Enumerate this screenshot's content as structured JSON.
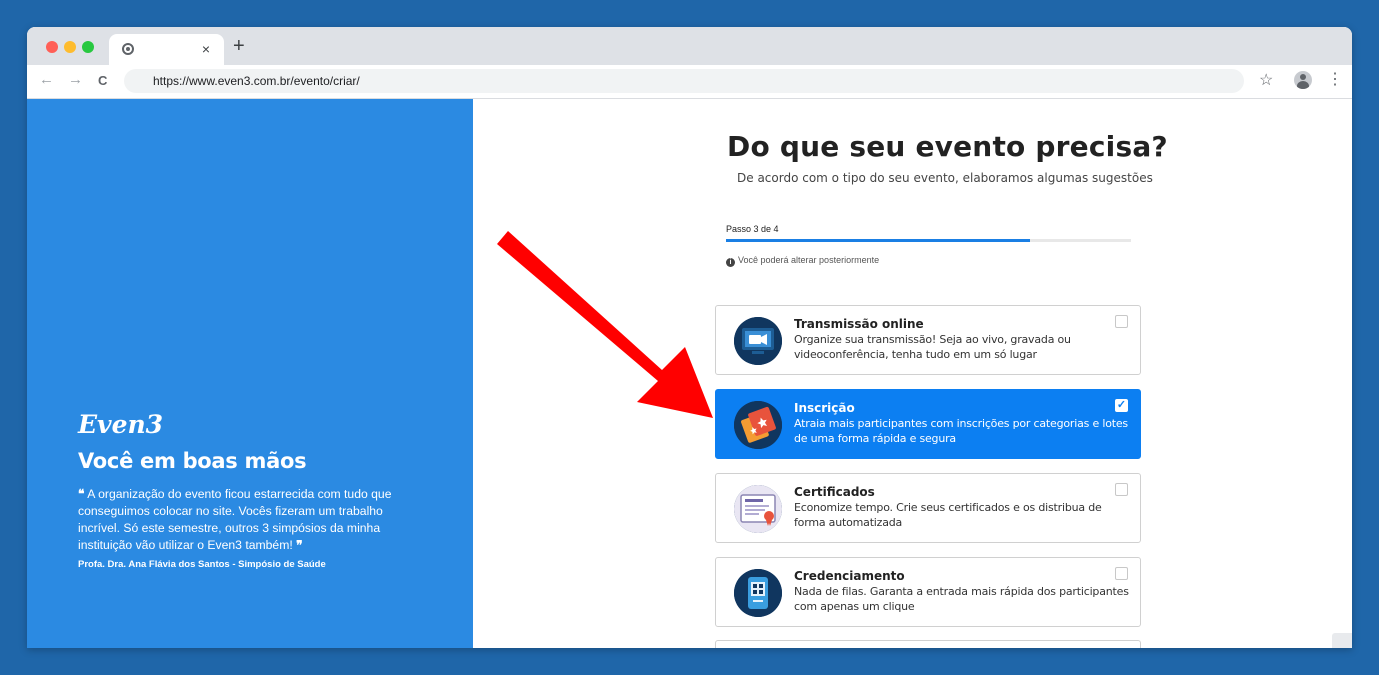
{
  "browser": {
    "tab_close": "×",
    "new_tab": "+",
    "back": "←",
    "forward": "→",
    "reload": "C",
    "url": "https://www.even3.com.br/evento/criar/",
    "star": "☆",
    "menu": "⋮",
    "colors": {
      "close": "#ff5f57",
      "minimize": "#febc2e",
      "maximize": "#28c840"
    }
  },
  "sidebar": {
    "logo": "Even3",
    "tagline": "Você em boas mãos",
    "open_quote": "❝",
    "testimonial": "A organização do evento ficou estarrecida com tudo que conseguimos colocar no site. Vocês fizeram um trabalho incrível. Só este semestre, outros 3 simpósios da minha instituição vão utilizar o Even3 também!",
    "close_quote": "❞",
    "author": "Profa. Dra. Ana Flávia dos Santos - Simpósio de Saúde",
    "background_color": "#2b8ae2"
  },
  "main": {
    "title": "Do que seu evento precisa?",
    "subtitle": "De acordo com o tipo do seu evento, elaboramos algumas sugestões",
    "step_label": "Passo 3 de 4",
    "progress_fraction": 0.75,
    "note_icon": "i",
    "note": "Você poderá alterar posteriormente",
    "checkmark": "✓",
    "options": [
      {
        "title": "Transmissão online",
        "description": "Organize sua transmissão! Seja ao vivo, gravada ou videoconferência, tenha tudo em um só lugar",
        "icon": "video-camera-icon",
        "selected": false
      },
      {
        "title": "Inscrição",
        "description": "Atraia mais participantes com inscrições por categorias e lotes de uma forma rápida e segura",
        "icon": "ticket-icon",
        "selected": true
      },
      {
        "title": "Certificados",
        "description": "Economize tempo. Crie seus certificados e os distribua de forma automatizada",
        "icon": "certificate-icon",
        "selected": false
      },
      {
        "title": "Credenciamento",
        "description": "Nada de filas. Garanta a entrada mais rápida dos participantes com apenas um clique",
        "icon": "qr-badge-icon",
        "selected": false
      }
    ],
    "selected_color": "#0c7ff2",
    "annotation_arrow_color": "#ff0000"
  }
}
